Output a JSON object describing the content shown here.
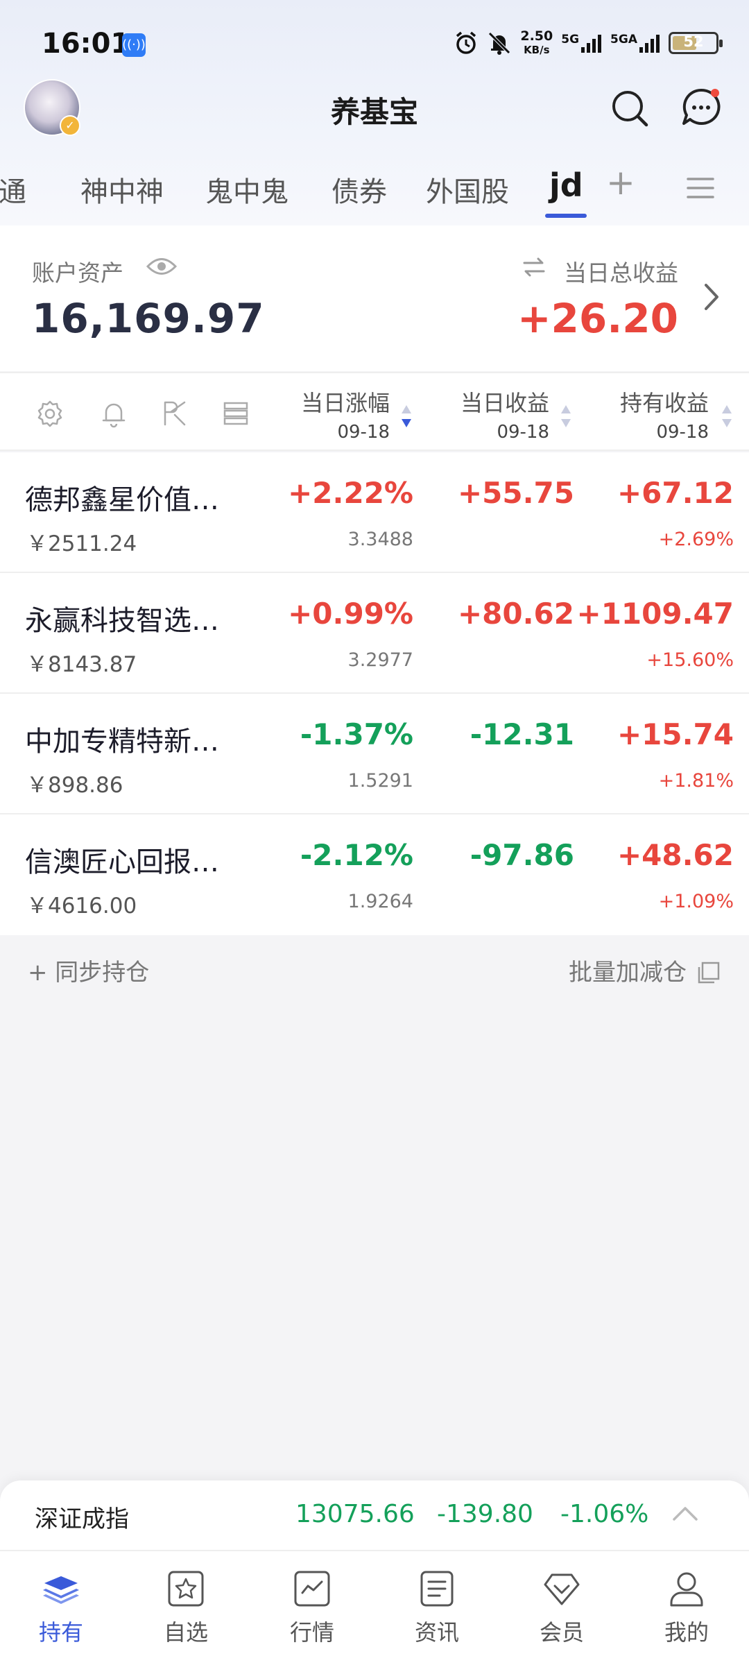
{
  "status_bar": {
    "time": "16:01",
    "speed_value": "2.50",
    "speed_unit": "KB/s",
    "net1": "5G",
    "net2": "5GA",
    "battery": "52"
  },
  "app": {
    "title": "养基宝"
  },
  "tabs": [
    {
      "label": "财通"
    },
    {
      "label": "神中神"
    },
    {
      "label": "鬼中鬼"
    },
    {
      "label": "债券"
    },
    {
      "label": "外国股"
    },
    {
      "label": "jd"
    }
  ],
  "account": {
    "assets_label": "账户资产",
    "assets_value": "16,169.97",
    "daily_label": "当日总收益",
    "daily_value": "+26.20"
  },
  "table_header": {
    "col1_title": "当日涨幅",
    "col1_date": "09-18",
    "col2_title": "当日收益",
    "col2_date": "09-18",
    "col3_title": "持有收益",
    "col3_date": "09-18"
  },
  "funds": [
    {
      "name": "德邦鑫星价值…",
      "amount": "￥2511.24",
      "change": "+2.22%",
      "nav": "3.3488",
      "day_gain": "+55.75",
      "hold_gain": "+67.12",
      "hold_pct": "+2.69%"
    },
    {
      "name": "永赢科技智选…",
      "amount": "￥8143.87",
      "change": "+0.99%",
      "nav": "3.2977",
      "day_gain": "+80.62",
      "hold_gain": "+1109.47",
      "hold_pct": "+15.60%"
    },
    {
      "name": "中加专精特新…",
      "amount": "￥898.86",
      "change": "-1.37%",
      "nav": "1.5291",
      "day_gain": "-12.31",
      "hold_gain": "+15.74",
      "hold_pct": "+1.81%"
    },
    {
      "name": "信澳匠心回报…",
      "amount": "￥4616.00",
      "change": "-2.12%",
      "nav": "1.9264",
      "day_gain": "-97.86",
      "hold_gain": "+48.62",
      "hold_pct": "+1.09%"
    }
  ],
  "actions": {
    "sync": "+ 同步持仓",
    "batch": "批量加减仓"
  },
  "ticker": {
    "name": "深证成指",
    "value": "13075.66",
    "change": "-139.80",
    "pct": "-1.06%"
  },
  "nav": [
    {
      "label": "持有",
      "icon": "layers-icon"
    },
    {
      "label": "自选",
      "icon": "star-icon"
    },
    {
      "label": "行情",
      "icon": "chart-icon"
    },
    {
      "label": "资讯",
      "icon": "document-icon"
    },
    {
      "label": "会员",
      "icon": "diamond-icon"
    },
    {
      "label": "我的",
      "icon": "user-icon"
    }
  ],
  "colors": {
    "up": "#e8463d",
    "down": "#14a05a",
    "accent": "#3a5ad9"
  }
}
